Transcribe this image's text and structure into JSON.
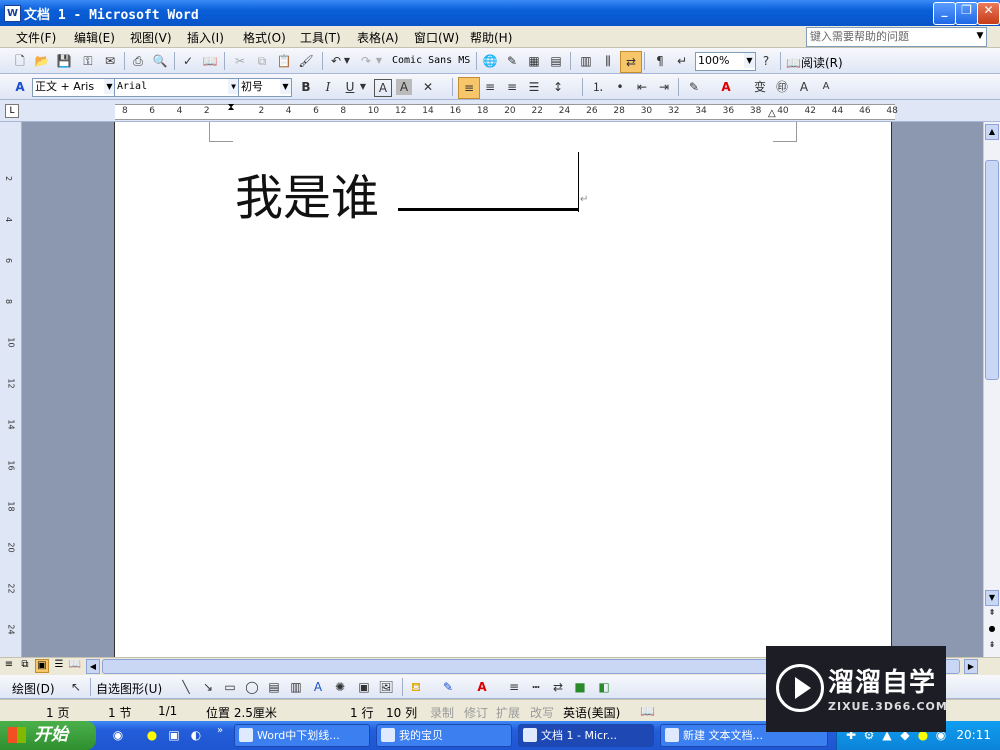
{
  "window": {
    "title": "文档 1 - Microsoft Word",
    "icon": "word-doc-icon"
  },
  "window_buttons": {
    "minimize": "_",
    "restore": "❐",
    "close": "✕"
  },
  "menu": [
    "文件(F)",
    "编辑(E)",
    "视图(V)",
    "插入(I)",
    "格式(O)",
    "工具(T)",
    "表格(A)",
    "窗口(W)",
    "帮助(H)"
  ],
  "help_placeholder": "键入需要帮助的问题",
  "standard_toolbar": {
    "font_display": "Comic Sans MS",
    "zoom": "100%",
    "read_label": "阅读(R)"
  },
  "format_toolbar": {
    "style": "正文 + Aris",
    "font": "Arial",
    "size": "初号",
    "bold": "B",
    "italic": "I",
    "underline": "U"
  },
  "ruler_numbers": [
    "8",
    "6",
    "4",
    "2",
    "2",
    "4",
    "6",
    "8",
    "10",
    "12",
    "14",
    "16",
    "18",
    "20",
    "22",
    "24",
    "26",
    "28",
    "30",
    "32",
    "34",
    "36",
    "38",
    "40",
    "42",
    "44",
    "46",
    "48"
  ],
  "vruler_numbers": [
    "2",
    "4",
    "6",
    "8",
    "10",
    "12",
    "14",
    "16",
    "18",
    "20",
    "22",
    "24"
  ],
  "document": {
    "text": "我是谁"
  },
  "draw_toolbar": {
    "draw_label": "绘图(D)",
    "autoshapes_label": "自选图形(U)"
  },
  "status": {
    "page": "1 页",
    "section": "1 节",
    "page_of": "1/1",
    "position": "位置 2.5厘米",
    "line": "1 行",
    "column": "10 列",
    "rec": "录制",
    "trk": "修订",
    "ext": "扩展",
    "ovr": "改写",
    "language": "英语(美国)"
  },
  "taskbar": {
    "start": "开始",
    "tasks": [
      "Word中下划线...",
      "我的宝贝",
      "文档 1 - Micr...",
      "新建 文本文档..."
    ],
    "clock": "20:11"
  },
  "watermark": {
    "name": "溜溜自学",
    "url": "ZIXUE.3D66.COM"
  }
}
